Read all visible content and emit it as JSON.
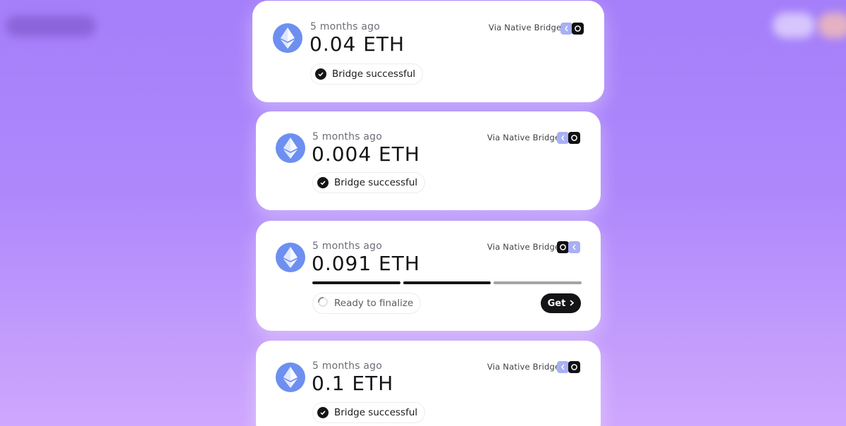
{
  "transactions": [
    {
      "time": "5 months ago",
      "amount": "0.04 ETH",
      "via": "Via Native Bridge",
      "status": "Bridge successful",
      "chain_order": [
        "lavender-chain-icon",
        "dark-chain-icon"
      ]
    },
    {
      "time": "5 months ago",
      "amount": "0.004 ETH",
      "via": "Via Native Bridge",
      "status": "Bridge successful",
      "chain_order": [
        "lavender-chain-icon",
        "dark-chain-icon"
      ]
    },
    {
      "time": "5 months ago",
      "amount": "0.091 ETH",
      "via": "Via Native Bridge",
      "status": "Ready to finalize",
      "progress_steps_completed": 2,
      "progress_steps_total": 3,
      "action_label": "Get",
      "chain_order": [
        "dark-chain-icon",
        "lavender-chain-icon"
      ]
    },
    {
      "time": "5 months ago",
      "amount": "0.1 ETH",
      "via": "Via Native Bridge",
      "status": "Bridge successful",
      "chain_order": [
        "lavender-chain-icon",
        "dark-chain-icon"
      ]
    }
  ],
  "colors": {
    "background_top": "#a57ffa",
    "background_bottom": "#cfa7fd",
    "eth_token": "#6d8ff0",
    "button": "#141417"
  }
}
